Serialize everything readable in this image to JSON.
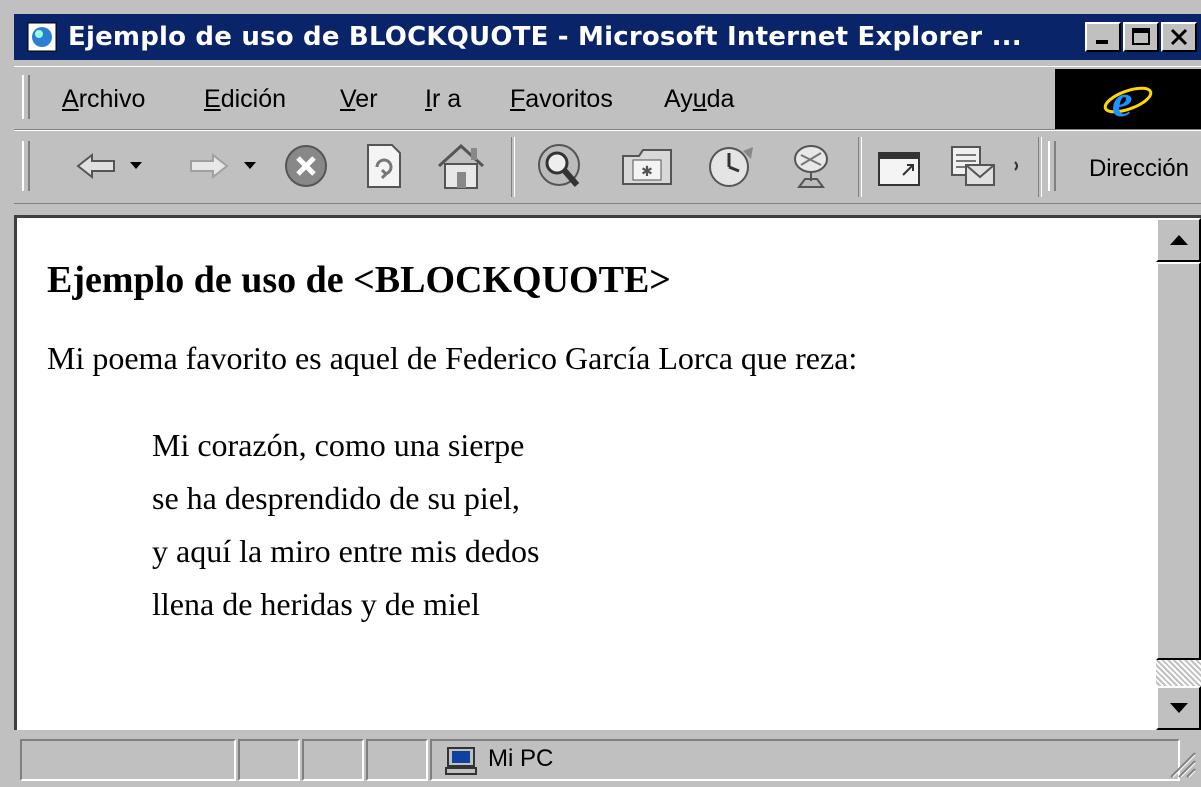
{
  "window": {
    "title": "Ejemplo de uso de BLOCKQUOTE - Microsoft Internet Explorer ...",
    "colors": {
      "titlebar": "#0a246a",
      "chrome": "#c0c0c0",
      "ie_logo": "#1e90ff"
    }
  },
  "menu": [
    {
      "accel": "A",
      "rest": "rchivo"
    },
    {
      "accel": "E",
      "rest": "dición"
    },
    {
      "accel": "V",
      "rest": "er"
    },
    {
      "accel": "I",
      "rest": "r a"
    },
    {
      "accel": "F",
      "rest": "avoritos"
    },
    {
      "pre": "Ay",
      "accel": "u",
      "rest": "da"
    }
  ],
  "toolbar": {
    "icons": [
      "back-icon",
      "dropdown-icon",
      "forward-icon",
      "dropdown-icon",
      "stop-icon",
      "refresh-icon",
      "home-icon",
      "search-icon",
      "favorites-icon",
      "history-icon",
      "channels-icon",
      "fullscreen-icon",
      "mail-icon"
    ],
    "address_label": "Dirección"
  },
  "page": {
    "heading": "Ejemplo de uso de <BLOCKQUOTE>",
    "intro": "Mi poema favorito es aquel de Federico García Lorca que reza:",
    "quote": [
      "Mi corazón, como una sierpe",
      "se ha desprendido de su piel,",
      "y aquí la miro entre mis dedos",
      "llena de heridas y de miel"
    ]
  },
  "status": {
    "zone": "Mi PC"
  }
}
